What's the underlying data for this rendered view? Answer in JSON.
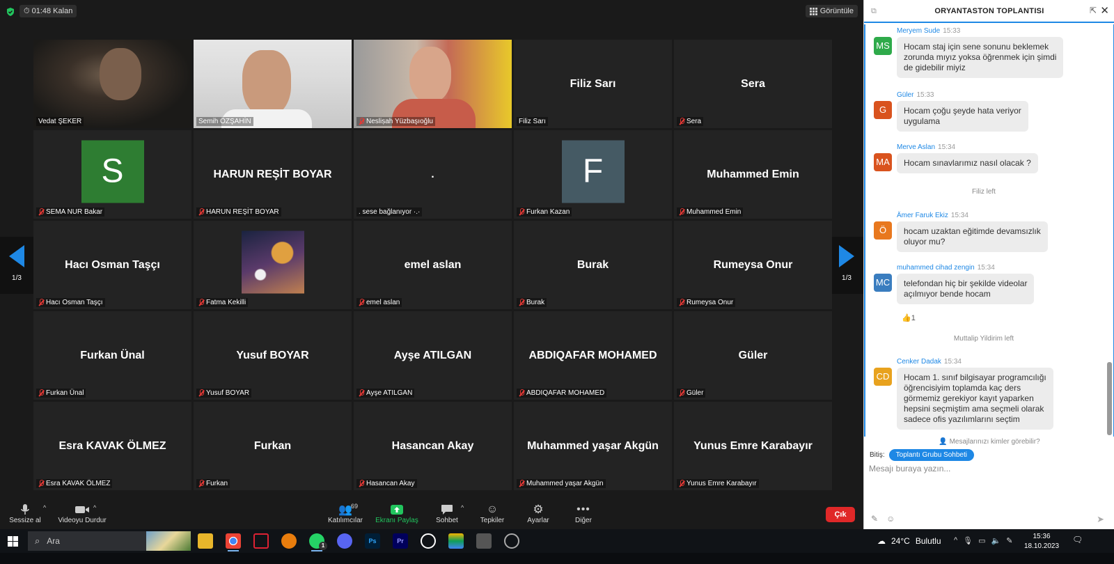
{
  "meeting": {
    "timer": "01:48 Kalan",
    "view_label": "Görüntüle",
    "page_indicator": "1/3",
    "tiles": [
      {
        "id": "t1",
        "big": "",
        "name": "Vedat ŞEKER",
        "muted": false,
        "type": "video",
        "active": true
      },
      {
        "id": "t2",
        "big": "",
        "name": "Semih ÖZŞAHİN",
        "muted": false,
        "type": "video"
      },
      {
        "id": "t3",
        "big": "",
        "name": "Nesliṣah Yüzbaşıoğlu",
        "muted": true,
        "type": "video"
      },
      {
        "id": "t4",
        "big": "Filiz Sarı",
        "name": "Filiz Sarı",
        "muted": false,
        "type": "text"
      },
      {
        "id": "t5",
        "big": "Sera",
        "name": "Sera",
        "muted": true,
        "type": "text"
      },
      {
        "id": "t6",
        "big": "",
        "name": "SEMA NUR Bakar",
        "muted": true,
        "type": "avatar",
        "letter": "S",
        "color": "#2e7d32"
      },
      {
        "id": "t7",
        "big": "HARUN REŞİT BOYAR",
        "name": "HARUN REŞİT BOYAR",
        "muted": true,
        "type": "text"
      },
      {
        "id": "t8",
        "big": ".",
        "name": ". sese bağlanıyor ·.·",
        "muted": false,
        "type": "text"
      },
      {
        "id": "t9",
        "big": "",
        "name": "Furkan Kazan",
        "muted": true,
        "type": "avatar",
        "letter": "F",
        "color": "#455a64"
      },
      {
        "id": "t10",
        "big": "Muhammed Emin",
        "name": "Muhammed Emin",
        "muted": true,
        "type": "text"
      },
      {
        "id": "t11",
        "big": "Hacı Osman Taşçı",
        "name": "Hacı Osman Taşçı",
        "muted": true,
        "type": "text"
      },
      {
        "id": "t12",
        "big": "",
        "name": "Fatma Kekilli",
        "muted": true,
        "type": "image"
      },
      {
        "id": "t13",
        "big": "emel aslan",
        "name": "emel aslan",
        "muted": true,
        "type": "text"
      },
      {
        "id": "t14",
        "big": "Burak",
        "name": "Burak",
        "muted": true,
        "type": "text"
      },
      {
        "id": "t15",
        "big": "Rumeysa Onur",
        "name": "Rumeysa Onur",
        "muted": true,
        "type": "text"
      },
      {
        "id": "t16",
        "big": "Furkan Ünal",
        "name": "Furkan Ünal",
        "muted": true,
        "type": "text"
      },
      {
        "id": "t17",
        "big": "Yusuf BOYAR",
        "name": "Yusuf BOYAR",
        "muted": true,
        "type": "text"
      },
      {
        "id": "t18",
        "big": "Ayşe ATILGAN",
        "name": "Ayşe ATILGAN",
        "muted": true,
        "type": "text"
      },
      {
        "id": "t19",
        "big": "ABDIQAFAR MOHAMED",
        "name": "ABDIQAFAR MOHAMED",
        "muted": true,
        "type": "text"
      },
      {
        "id": "t20",
        "big": "Güler",
        "name": "Güler",
        "muted": true,
        "type": "text"
      },
      {
        "id": "t21",
        "big": "Esra KAVAK ÖLMEZ",
        "name": "Esra KAVAK ÖLMEZ",
        "muted": true,
        "type": "text"
      },
      {
        "id": "t22",
        "big": "Furkan",
        "name": "Furkan",
        "muted": true,
        "type": "text"
      },
      {
        "id": "t23",
        "big": "Hasancan Akay",
        "name": "Hasancan Akay",
        "muted": true,
        "type": "text"
      },
      {
        "id": "t24",
        "big": "Muhammed yaşar Akgün",
        "name": "Muhammed yaşar Akgün",
        "muted": true,
        "type": "text"
      },
      {
        "id": "t25",
        "big": "Yunus Emre Karabayır",
        "name": "Yunus Emre Karabayır",
        "muted": true,
        "type": "text"
      }
    ]
  },
  "toolbar": {
    "mute_label": "Sessize al",
    "video_label": "Videoyu Durdur",
    "participants_label": "Katılımcılar",
    "participants_count": "69",
    "share_label": "Ekranı Paylaş",
    "chat_label": "Sohbet",
    "reactions_label": "Tepkiler",
    "settings_label": "Ayarlar",
    "more_label": "Diğer",
    "leave_label": "Çık",
    "share_color": "#22c55e",
    "leave_color": "#e02828"
  },
  "chat": {
    "title": "ORYANTASTON TOPLANTISI",
    "messages": [
      {
        "sender": "Meryem Sude",
        "time": "15:33",
        "initials": "MS",
        "color": "#2eaa4a",
        "text": "Hocam staj için sene sonunu beklemek\nzorunda mıyız yoksa öğrenmek için şimdi\nde gidebilir miyiz"
      },
      {
        "sender": "Güler",
        "time": "15:33",
        "initials": "G",
        "color": "#d9531e",
        "text": "Hocam çoğu şeyde hata veriyor\nuygulama"
      },
      {
        "sender": "Merve Aslan",
        "time": "15:34",
        "initials": "MA",
        "color": "#d9531e",
        "text": "Hocam sınavlarımız nasıl olacak ?"
      },
      {
        "sender": "Ämer Faruk Ekiz",
        "time": "15:34",
        "initials": "Ö",
        "color": "#e8781e",
        "text": "hocam uzaktan eğitimde devamsızlık\noluyor mu?"
      },
      {
        "sender": "muhammed cihad zengin",
        "time": "15:34",
        "initials": "MC",
        "color": "#3a7dbf",
        "text": "telefondan hiç bir şekilde videolar\naçılmıyor bende hocam"
      },
      {
        "sender": "Cenker Dadak",
        "time": "15:34",
        "initials": "CD",
        "color": "#e8a21e",
        "text": "Hocam 1. sınıf bilgisayar programcılığı\nöğrencisiyim toplamda kaç ders\ngörmemiz gerekiyor kayıt yaparken\nhepsini seçmiştim ama seçmeli olarak\nsadece ofis yazılımlarını seçtim"
      }
    ],
    "system_left_1": "Filiz left",
    "system_left_2": "Muttalip Yildirim left",
    "reaction": "👍1",
    "visibility_note": "Mesajlarınızı kimler görebilir?",
    "to_label": "Bitiş:",
    "to_value": "Toplantı Grubu Sohbeti",
    "input_placeholder": "Mesajı buraya yazın..."
  },
  "taskbar": {
    "search_placeholder": "Ara",
    "weather_temp": "24°C",
    "weather_text": "Bulutlu",
    "time": "15:36",
    "date": "18.10.2023",
    "whatsapp_badge": "1"
  }
}
